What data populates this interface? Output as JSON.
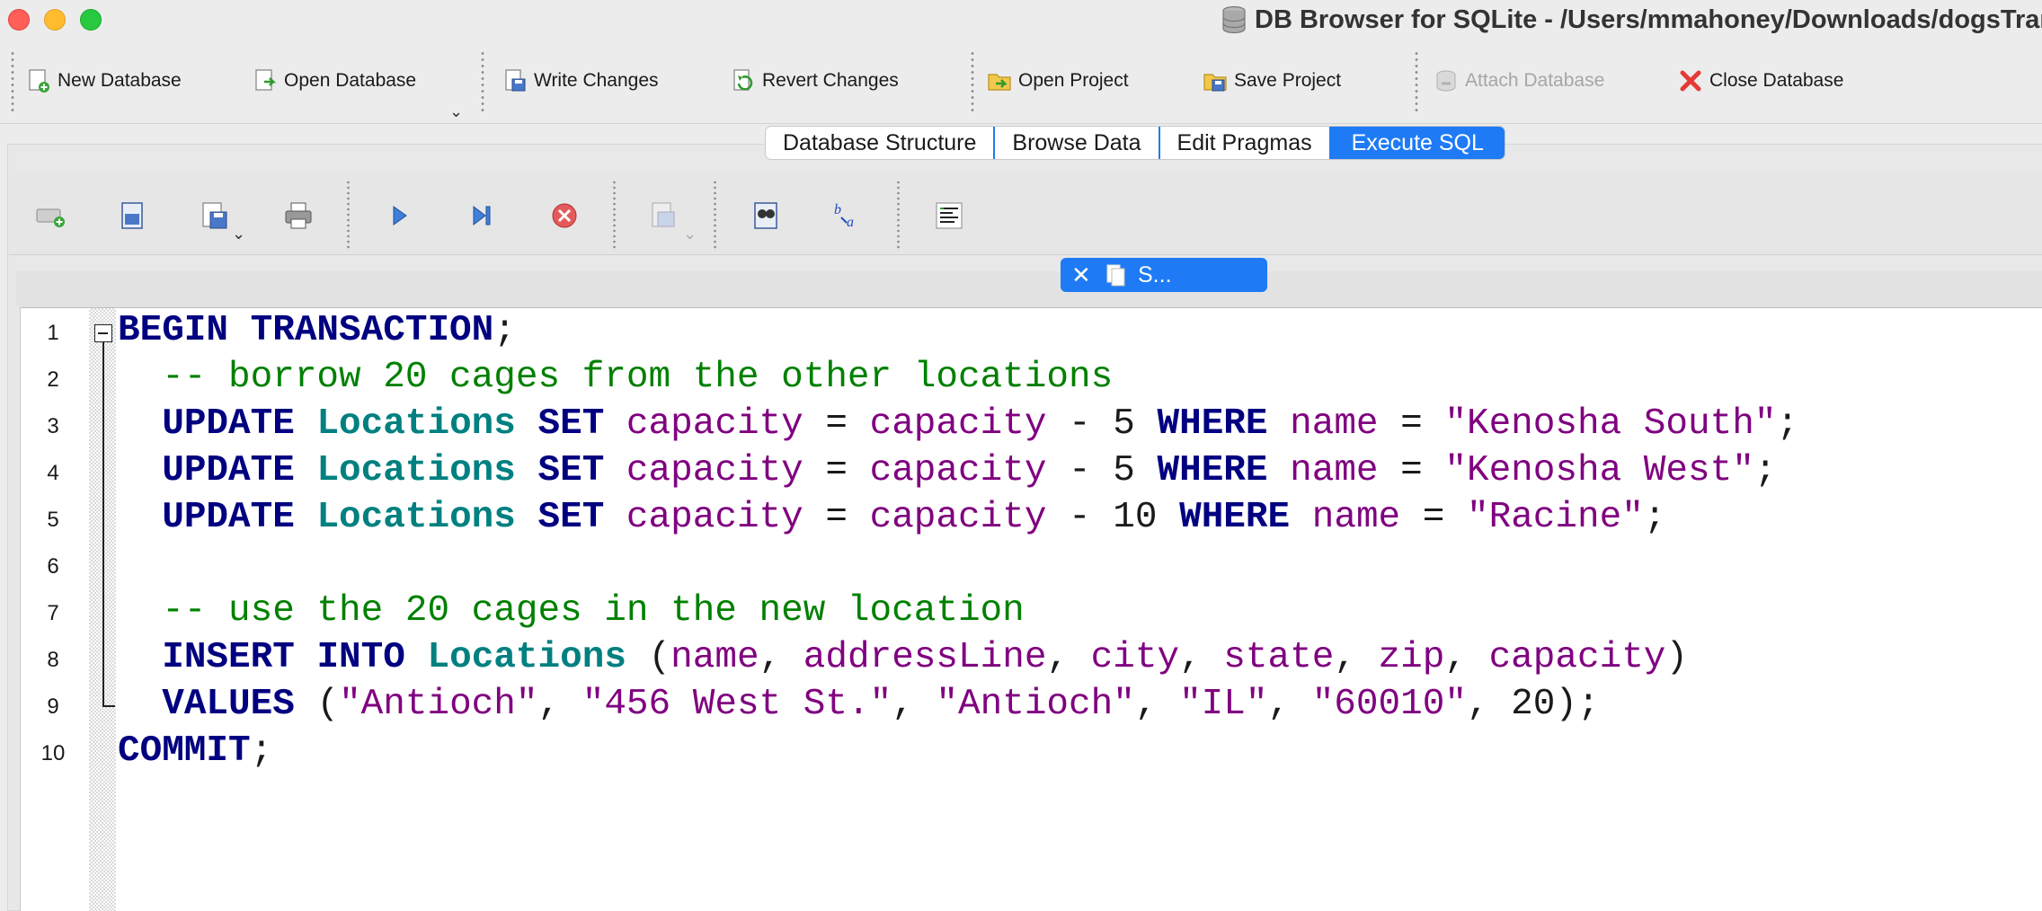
{
  "window": {
    "title": "DB Browser for SQLite - /Users/mmahoney/Downloads/dogsTransac"
  },
  "toolbar": {
    "new_database": "New Database",
    "open_database": "Open Database",
    "write_changes": "Write Changes",
    "revert_changes": "Revert Changes",
    "open_project": "Open Project",
    "save_project": "Save Project",
    "attach_database": "Attach Database",
    "close_database": "Close Database"
  },
  "tabs": [
    {
      "label": "Database Structure",
      "active": false
    },
    {
      "label": "Browse Data",
      "active": false
    },
    {
      "label": "Edit Pragmas",
      "active": false
    },
    {
      "label": "Execute SQL",
      "active": true
    }
  ],
  "sql_toolbar": {
    "icons": [
      "open-tab-icon",
      "open-sql-file-icon",
      "save-sql-file-icon",
      "print-icon",
      "execute-all-icon",
      "execute-current-line-icon",
      "stop-execution-icon",
      "save-results-icon",
      "find-icon",
      "find-replace-icon",
      "comment-toggle-icon"
    ]
  },
  "editor_tab": {
    "label": "S..."
  },
  "editor": {
    "line_numbers": [
      "1",
      "2",
      "3",
      "4",
      "5",
      "6",
      "7",
      "8",
      "9",
      "10"
    ],
    "code": {
      "l1_kw": "BEGIN TRANSACTION",
      "l1_semi": ";",
      "l2_comment": "  -- borrow 20 cages from the other locations",
      "l3": {
        "kw1": "UPDATE",
        "tbl": "Locations",
        "kw2": "SET",
        "col1": "capacity",
        "eq1": "=",
        "col2": "capacity",
        "op": "-",
        "num": "5",
        "kw3": "WHERE",
        "col3": "name",
        "eq2": "=",
        "str": "\"Kenosha South\"",
        "end": ";"
      },
      "l4": {
        "kw1": "UPDATE",
        "tbl": "Locations",
        "kw2": "SET",
        "col1": "capacity",
        "eq1": "=",
        "col2": "capacity",
        "op": "-",
        "num": "5",
        "kw3": "WHERE",
        "col3": "name",
        "eq2": "=",
        "str": "\"Kenosha West\"",
        "end": ";"
      },
      "l5": {
        "kw1": "UPDATE",
        "tbl": "Locations",
        "kw2": "SET",
        "col1": "capacity",
        "eq1": "=",
        "col2": "capacity",
        "op": "-",
        "num": "10",
        "kw3": "WHERE",
        "col3": "name",
        "eq2": "=",
        "str": "\"Racine\"",
        "end": ";"
      },
      "l7_comment": "  -- use the 20 cages in the new location",
      "l8": {
        "kw": "INSERT INTO",
        "tbl": "Locations",
        "open": "(",
        "cols": [
          "name",
          "addressLine",
          "city",
          "state",
          "zip",
          "capacity"
        ],
        "close": ")"
      },
      "l9": {
        "kw": "VALUES",
        "open": "(",
        "vals": [
          "\"Antioch\"",
          "\"456 West St.\"",
          "\"Antioch\"",
          "\"IL\"",
          "\"60010\""
        ],
        "num": "20",
        "close": ");"
      },
      "l10_kw": "COMMIT",
      "l10_semi": ";"
    }
  },
  "colors": {
    "keyword": "#000080",
    "table": "#008080",
    "identifier": "#800080",
    "comment": "#008000",
    "accent": "#1f7bf5"
  }
}
